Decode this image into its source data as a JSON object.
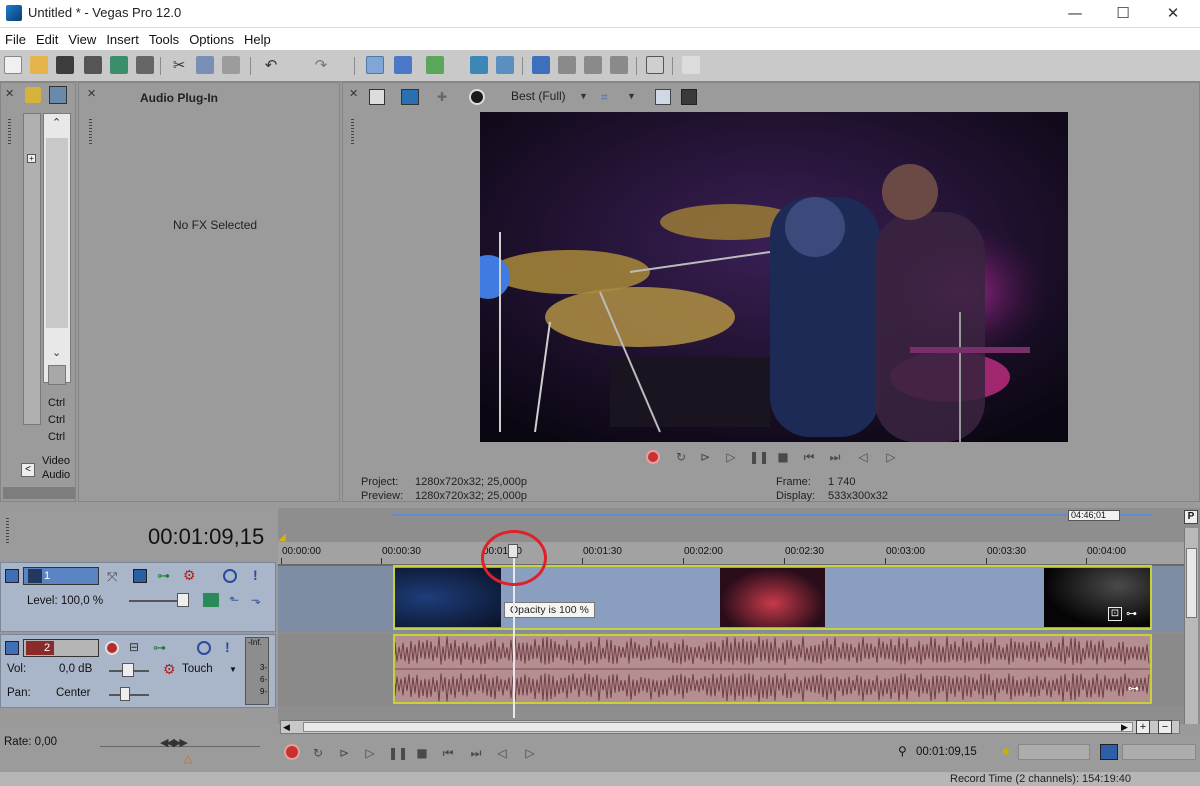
{
  "window": {
    "title": "Untitled * - Vegas Pro 12.0",
    "minimize": "—",
    "maximize": "☐",
    "close": "✕"
  },
  "menu": [
    "File",
    "Edit",
    "View",
    "Insert",
    "Tools",
    "Options",
    "Help"
  ],
  "left_panel": {
    "ctrl_labels": [
      "Ctrl",
      "Ctrl",
      "Ctrl"
    ],
    "tab_video": "Video",
    "tab_audio": "Audio"
  },
  "plugin_panel": {
    "title": "Audio Plug-In",
    "empty_text": "No FX Selected"
  },
  "preview": {
    "quality": "Best (Full)",
    "project_label": "Project:",
    "project_value": "1280x720x32; 25,000p",
    "preview_label": "Preview:",
    "preview_value": "1280x720x32; 25,000p",
    "frame_label": "Frame:",
    "frame_value": "1 740",
    "display_label": "Display:",
    "display_value": "533x300x32"
  },
  "timeline": {
    "timecode": "00:01:09,15",
    "loop_end": "04:46;01",
    "ruler": [
      "00:00:00",
      "00:00:30",
      "00:01:00",
      "00:01:30",
      "00:02:00",
      "00:02:30",
      "00:03:00",
      "00:03:30",
      "00:04:00"
    ],
    "tooltip": "Opacity is 100 %",
    "cursor_time_fraction": 0.29
  },
  "tracks": {
    "video": {
      "number": "1",
      "level_label": "Level: 100,0 %",
      "level_percent": 100
    },
    "audio": {
      "number": "2",
      "vol_label": "Vol:",
      "vol_value": "0,0 dB",
      "pan_label": "Pan:",
      "pan_value": "Center",
      "automation": "Touch",
      "meter_label": "-Inf.",
      "meter_ticks": [
        "3-",
        "6-",
        "9-"
      ]
    }
  },
  "bottom": {
    "rate": "Rate: 0,00",
    "cursor_time": "00:01:09,15",
    "record_time": "Record Time (2 channels): 154:19:40"
  },
  "colors": {
    "accent_yellow": "#c7d13a",
    "record_red": "#d23030",
    "highlight_circle": "#e0202b"
  }
}
